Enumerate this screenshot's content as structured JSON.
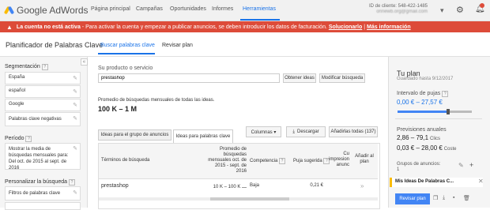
{
  "topnav": {
    "logo_text": "Google AdWords",
    "items": [
      "Página principal",
      "Campañas",
      "Oportunidades",
      "Informes",
      "Herramientas"
    ],
    "client_id": "ID de cliente: 548-422-1485",
    "client_email": "onnewb.org@gmail.com"
  },
  "alert": {
    "bold": "La cuenta no está activa",
    "text": " - Para activar la cuenta y empezar a publicar anuncios, se deben introducir los datos de facturación. ",
    "link1": "Solucionarlo",
    "sep": " | ",
    "link2": "Más información"
  },
  "page": {
    "title": "Planificador de Palabras Clave",
    "tab_active": "Buscar palabras clave",
    "tab_other": "Revisar plan"
  },
  "left": {
    "collapse": "«",
    "seg_title": "Segmentación",
    "seg_items": [
      "España",
      "español",
      "Google",
      "Palabras clave negativas"
    ],
    "period_title": "Período",
    "period_text": "Mostrar la media de búsquedas mensuales para: Del oct. de 2015 al sept. de 2016",
    "custom_title": "Personalizar la búsqueda",
    "custom_item": "Filtros de palabras clave"
  },
  "search": {
    "label": "Su producto o servicio",
    "value": "prestashop",
    "btn_ideas": "Obtener ideas",
    "btn_modify": "Modificar búsqueda"
  },
  "stats": {
    "label": "Promedio de búsquedas mensuales de todas las ideas.",
    "value": "100 K – 1 M"
  },
  "tabs": {
    "adgroups": "Ideas para el grupo de anuncios",
    "keywords": "Ideas para palabras clave",
    "columns": "Columnas ▾",
    "download": "Descargar",
    "addall": "Añadirlas todas (137)"
  },
  "table": {
    "headers": [
      "Términos de búsqueda",
      "Promedio de búsquedas mensuales oct. de 2015 - sept. de 2016",
      "Competencia",
      "Puja sugerida",
      "Cu impresion anunc",
      "Añadir al plan"
    ],
    "rows": [
      {
        "term": "prestashop",
        "avg": "10 K – 100 K",
        "comp": "Baja",
        "bid": "0,21 €",
        "add": "»"
      }
    ]
  },
  "plan": {
    "title": "Tu plan",
    "saved": "Guardado hasta 9/12/2017",
    "bid_label": "Intervalo de pujas",
    "bid_value": "0,00 € – 27,57 €",
    "proj_label": "Previsiones anuales",
    "clicks": "2,86 – 79,1",
    "clicks_unit": "Clics",
    "cost": "0,03 € – 28,00 €",
    "cost_unit": "Coste",
    "groups_label": "Grupos de anuncios:",
    "groups_count": "1",
    "plan_item": "Mis Ideas De Palabras C...",
    "review_btn": "Revisar plan"
  },
  "colors": {
    "accent": "#1a73e8",
    "alert": "#dd4b39",
    "review": "#4285f4"
  }
}
